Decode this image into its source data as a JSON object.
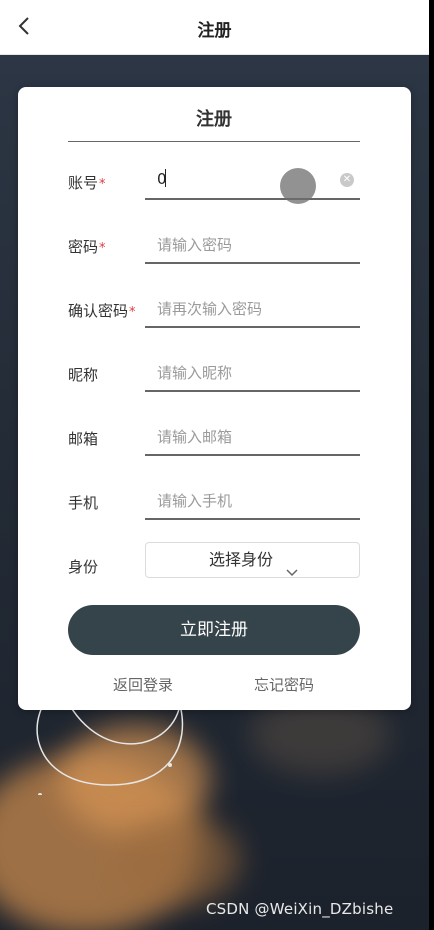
{
  "navbar": {
    "title": "注册"
  },
  "form": {
    "title": "注册",
    "fields": [
      {
        "label": "账号",
        "required": "*",
        "value": "0",
        "placeholder": ""
      },
      {
        "label": "密码",
        "required": "*",
        "value": "",
        "placeholder": "请输入密码"
      },
      {
        "label": "确认密码",
        "required": "*",
        "value": "",
        "placeholder": "请再次输入密码"
      },
      {
        "label": "昵称",
        "required": "",
        "value": "",
        "placeholder": "请输入昵称"
      },
      {
        "label": "邮箱",
        "required": "",
        "value": "",
        "placeholder": "请输入邮箱"
      },
      {
        "label": "手机",
        "required": "",
        "value": "",
        "placeholder": "请输入手机"
      }
    ],
    "identity": {
      "label": "身份",
      "selected": "选择身份"
    },
    "submit_label": "立即注册",
    "back_login_label": "返回登录",
    "forgot_password_label": "忘记密码"
  },
  "watermark": "CSDN @WeiXin_DZbishe"
}
